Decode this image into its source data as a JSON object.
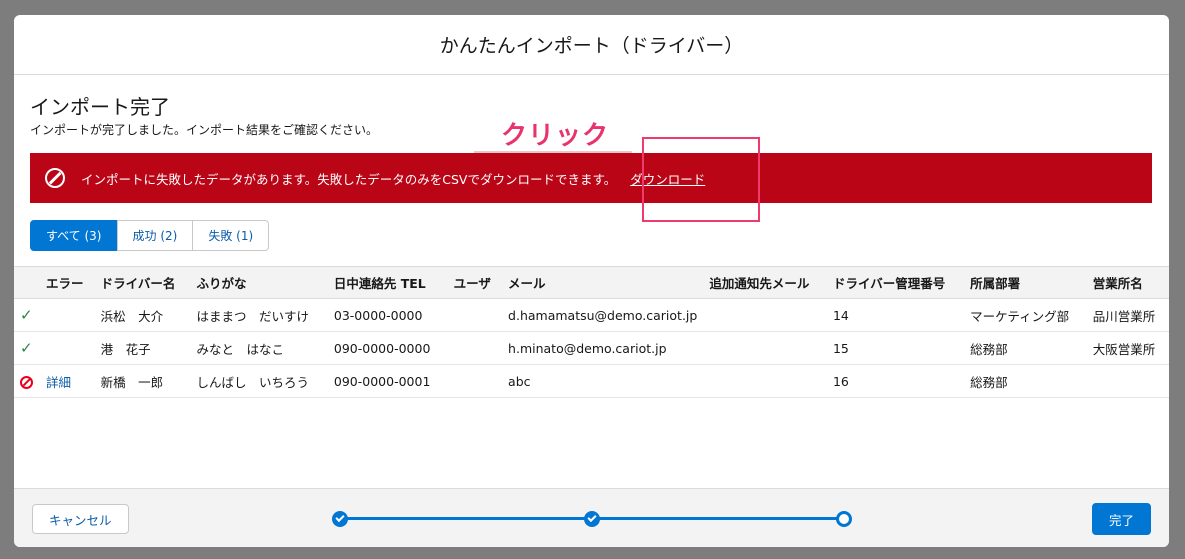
{
  "modal": {
    "title": "かんたんインポート（ドライバー）"
  },
  "page": {
    "title": "インポート完了",
    "subtitle": "インポートが完了しました。インポート結果をご確認ください。"
  },
  "annotation": {
    "label": "クリック",
    "color": "#e8336d"
  },
  "alert": {
    "icon": "ban-icon",
    "message": "インポートに失敗したデータがあります。失敗したデータのみをCSVでダウンロードできます。",
    "link_label": "ダウンロード",
    "color": "#ba0517"
  },
  "filters": [
    {
      "label": "すべて (3)",
      "active": true
    },
    {
      "label": "成功 (2)",
      "active": false
    },
    {
      "label": "失敗 (1)",
      "active": false
    }
  ],
  "table": {
    "columns": [
      "",
      "エラー",
      "ドライバー名",
      "ふりがな",
      "日中連絡先 TEL",
      "ユーザ",
      "メール",
      "追加通知先メール",
      "ドライバー管理番号",
      "所属部署",
      "営業所名"
    ],
    "rows": [
      {
        "status": "success",
        "error": "",
        "name": "浜松　大介",
        "kana": "はままつ　だいすけ",
        "tel": "03-0000-0000",
        "user": "",
        "email": "d.hamamatsu@demo.cariot.jp",
        "extra_email": "",
        "number": "14",
        "department": "マーケティング部",
        "office": "品川営業所"
      },
      {
        "status": "success",
        "error": "",
        "name": "港　花子",
        "kana": "みなと　はなこ",
        "tel": "090-0000-0000",
        "user": "",
        "email": "h.minato@demo.cariot.jp",
        "extra_email": "",
        "number": "15",
        "department": "総務部",
        "office": "大阪営業所"
      },
      {
        "status": "error",
        "error": "詳細",
        "name": "新橋　一郎",
        "kana": "しんばし　いちろう",
        "tel": "090-0000-0001",
        "user": "",
        "email": "abc",
        "extra_email": "",
        "number": "16",
        "department": "総務部",
        "office": ""
      }
    ]
  },
  "footer": {
    "cancel_label": "キャンセル",
    "done_label": "完了",
    "progress": {
      "steps": 3,
      "current": 3
    }
  },
  "colors": {
    "brand": "#0176d3",
    "success": "#2e844a",
    "error": "#ea001e"
  }
}
